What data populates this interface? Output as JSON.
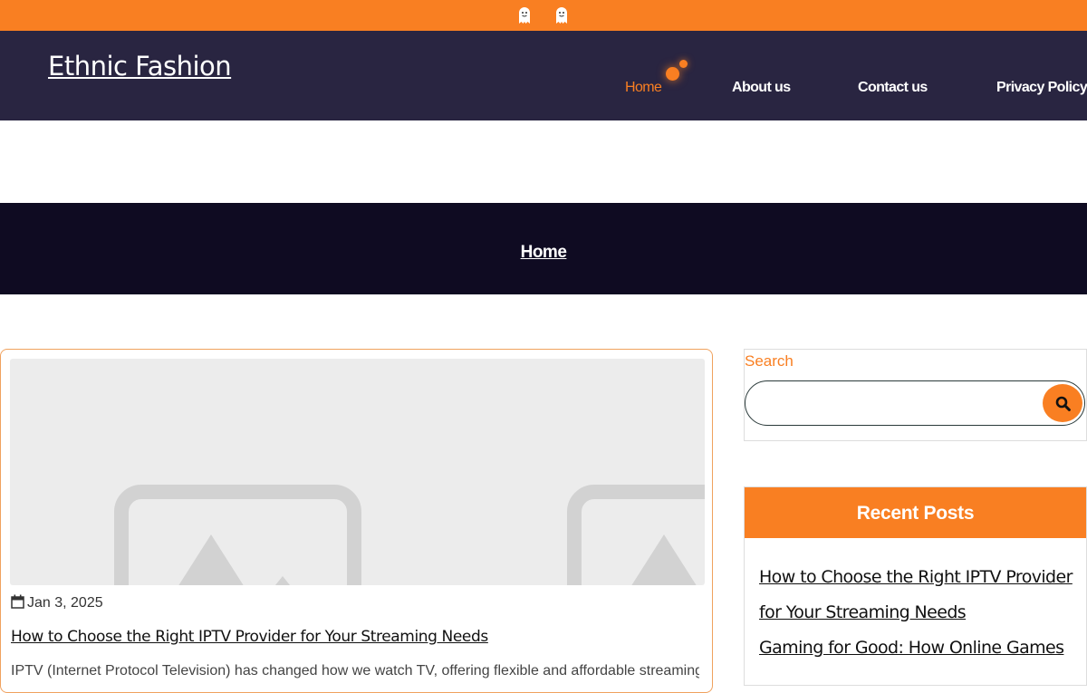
{
  "site": {
    "title": "Ethnic Fashion"
  },
  "nav": {
    "items": [
      {
        "label": "Home",
        "active": true
      },
      {
        "label": "About us"
      },
      {
        "label": "Contact us"
      },
      {
        "label": "Privacy Policy"
      }
    ]
  },
  "banner": {
    "title": "Home"
  },
  "post": {
    "date": "Jan 3, 2025",
    "title": "How to Choose the Right IPTV Provider for Your Streaming Needs",
    "excerpt": "IPTV (Internet Protocol Television) has changed how we watch TV, offering flexible and affordable streaming options"
  },
  "search": {
    "label": "Search",
    "value": "",
    "placeholder": ""
  },
  "recent_posts": {
    "heading": "Recent Posts",
    "items": [
      "How to Choose the Right IPTV Provider for Your Streaming Needs",
      "Gaming for Good: How Online Games"
    ]
  },
  "colors": {
    "accent": "#f97f22",
    "header_bg": "#292541",
    "banner_bg": "#0f0b22"
  },
  "icons": [
    "ghost-icon",
    "calendar-icon",
    "search-icon",
    "image-placeholder-icon"
  ]
}
